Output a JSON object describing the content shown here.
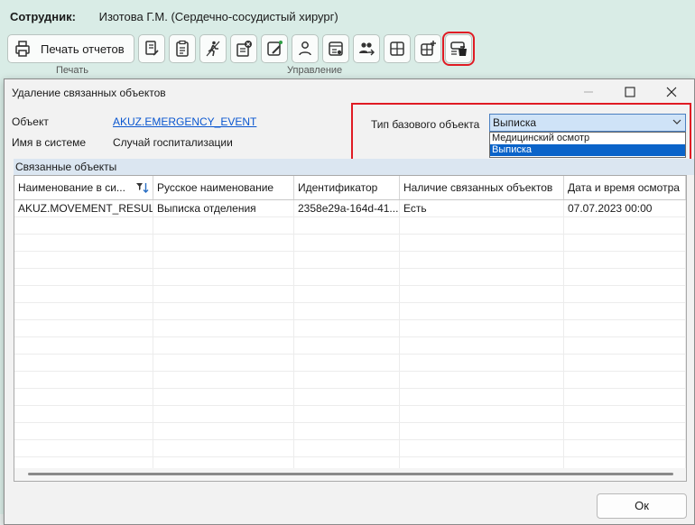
{
  "app": {
    "employee_label": "Сотрудник:",
    "employee_name": "Изотова Г.М. (Сердечно-сосудистый хирург)",
    "print_reports_label": "Печать отчетов",
    "group_print_label": "Печать",
    "group_manage_label": "Управление",
    "toolbar_icons": [
      "print-icon",
      "document-edit-icon",
      "clipboard-icon",
      "walking-person-icon",
      "document-cancel-icon",
      "edit-frame-icon",
      "person-route-icon",
      "list-card-icon",
      "people-transfer-icon",
      "layout-grid-icon",
      "add-grid-icon",
      "delete-card-icon"
    ],
    "accent_red": "#e01b24"
  },
  "dialog": {
    "title": "Удаление связанных объектов",
    "object_label": "Объект",
    "object_value": "AKUZ.EMERGENCY_EVENT",
    "system_name_label": "Имя в системе",
    "system_name_value": "Случай госпитализации",
    "base_type_label": "Тип базового объекта",
    "base_type_selected": "Выписка",
    "base_type_options": [
      "Медицинский осмотр",
      "Выписка"
    ],
    "related_group_label": "Связанные объекты",
    "columns": [
      "Наименование в си...",
      "Русское наименование",
      "Идентификатор",
      "Наличие связанных объектов",
      "Дата и время осмотра"
    ],
    "rows": [
      [
        "AKUZ.MOVEMENT_RESULT",
        "Выписка отделения",
        "2358e29a-164d-41...",
        "Есть",
        "07.07.2023 00:00"
      ]
    ],
    "ok_label": "Ок"
  }
}
